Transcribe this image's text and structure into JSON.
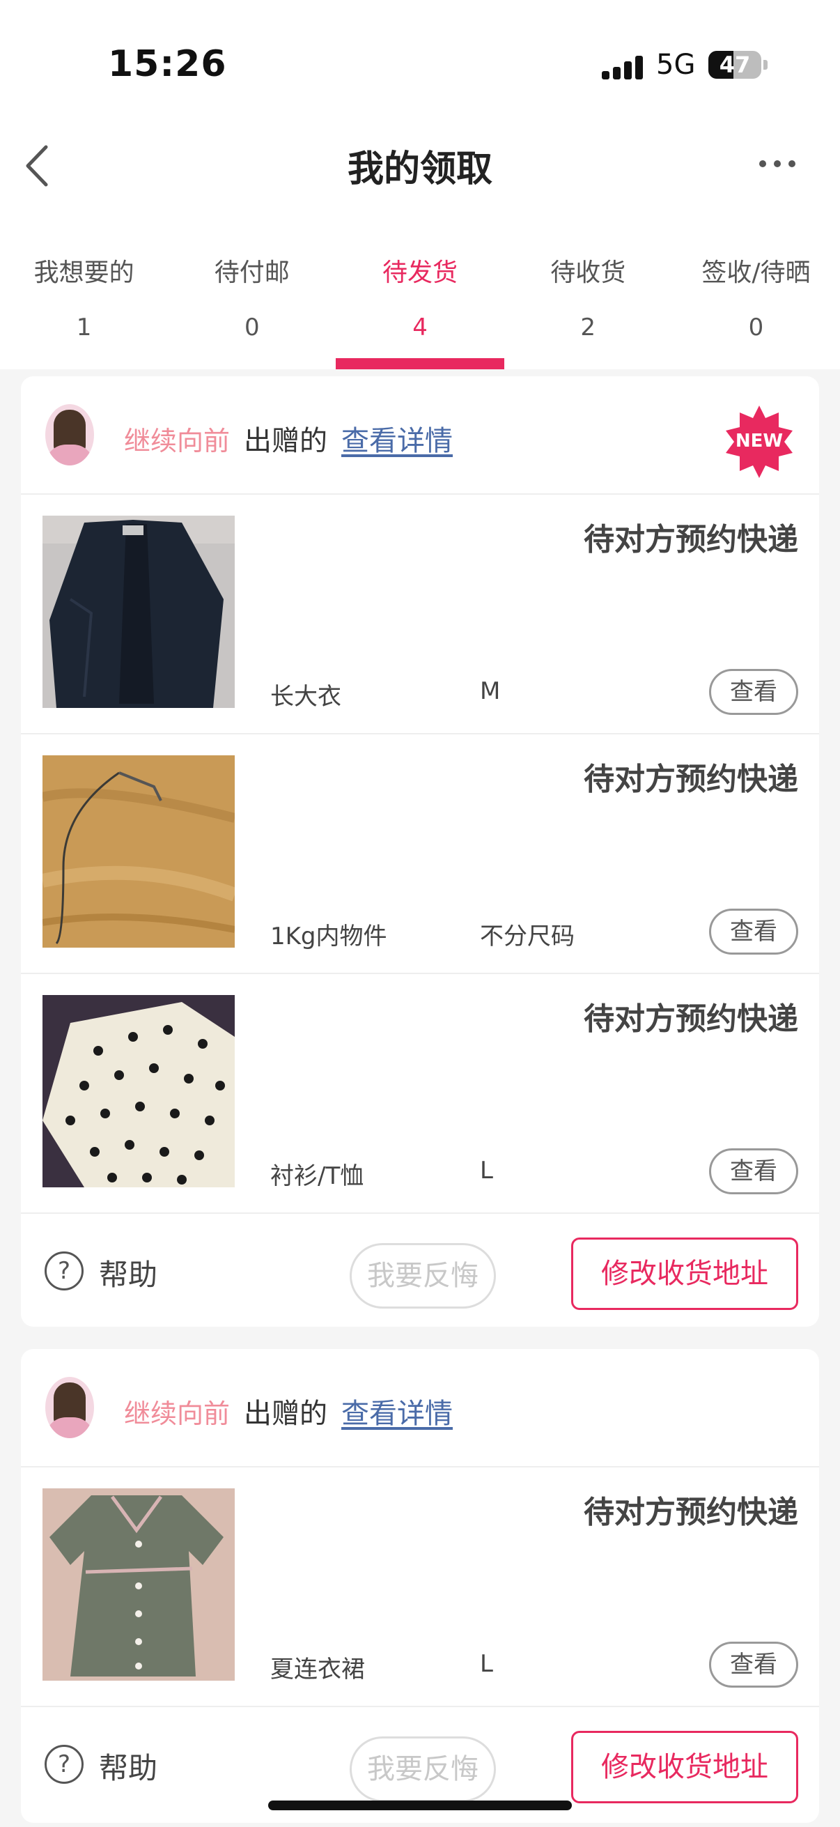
{
  "status_bar": {
    "time": "15:26",
    "network": "5G",
    "battery": "47",
    "battery_level": 0.47
  },
  "nav": {
    "title": "我的领取"
  },
  "tabs": [
    {
      "label": "我想要的",
      "count": "1"
    },
    {
      "label": "待付邮",
      "count": "0"
    },
    {
      "label": "待发货",
      "count": "4",
      "active": true
    },
    {
      "label": "待收货",
      "count": "2"
    },
    {
      "label": "签收/待晒",
      "count": "0"
    }
  ],
  "orders": [
    {
      "donor": "继续向前",
      "gave_text": "出赠的",
      "detail_link": "查看详情",
      "badge": "NEW",
      "items": [
        {
          "status": "待对方预约快递",
          "name": "长大衣",
          "size": "M",
          "view": "查看"
        },
        {
          "status": "待对方预约快递",
          "name": "1Kg内物件",
          "size": "不分尺码",
          "view": "查看"
        },
        {
          "status": "待对方预约快递",
          "name": "衬衫/T恤",
          "size": "L",
          "view": "查看"
        }
      ],
      "help": "帮助",
      "regret": "我要反悔",
      "change_address": "修改收货地址"
    },
    {
      "donor": "继续向前",
      "gave_text": "出赠的",
      "detail_link": "查看详情",
      "items": [
        {
          "status": "待对方预约快递",
          "name": "夏连衣裙",
          "size": "L",
          "view": "查看"
        }
      ],
      "help": "帮助",
      "regret": "我要反悔",
      "change_address": "修改收货地址"
    }
  ],
  "colors": {
    "accent": "#e8295f",
    "donor": "#f08c99",
    "link": "#4a6ba8"
  }
}
